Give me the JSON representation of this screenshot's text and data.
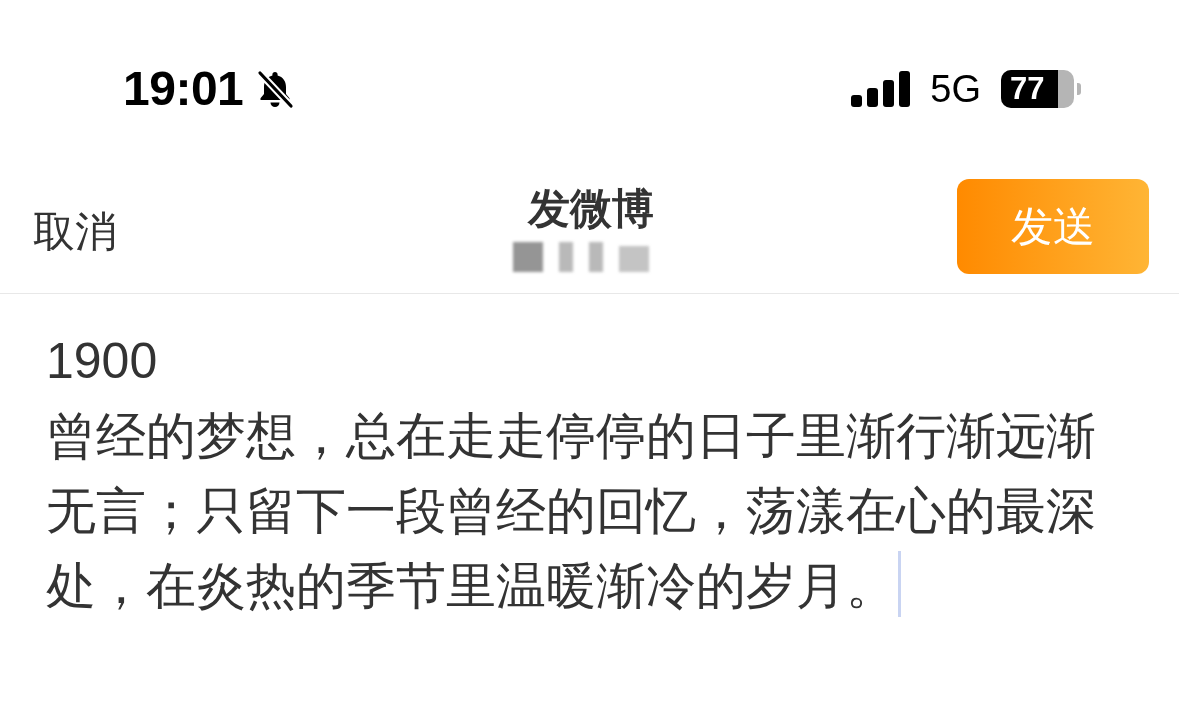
{
  "status_bar": {
    "time": "19:01",
    "network": "5G",
    "battery": "77"
  },
  "nav": {
    "cancel": "取消",
    "title": "发微博",
    "send": "发送"
  },
  "compose": {
    "value": "1900\n曾经的梦想，总在走走停停的日子里渐行渐远渐无言；只留下一段曾经的回忆，荡漾在心的最深处，在炎热的季节里温暖渐冷的岁月。"
  }
}
